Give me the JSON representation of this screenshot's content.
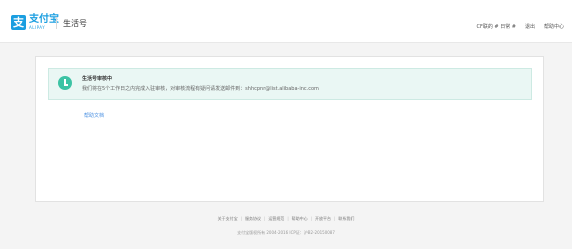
{
  "brand": {
    "logo_glyph": "支",
    "name_cn": "支付宝",
    "name_en": "ALIPAY",
    "color": "#1a9ee0"
  },
  "header": {
    "title": "生活号"
  },
  "topnav": {
    "account": "CF联的 # 日常 #",
    "logout": "退出",
    "help": "帮助中心"
  },
  "notice": {
    "icon": "check-circle-icon",
    "color": "#3cc3a4",
    "title": "生活号审核中",
    "description": "我们将在5个工作日之内完成入驻审核，对审核流程有疑问请发送邮件到：shhcpnr@list.alibaba-inc.com"
  },
  "help_link": "帮助文档",
  "footer": {
    "links": [
      "关于支付宝",
      "服务协议",
      "运营规范",
      "帮助中心",
      "开放平台",
      "联系我们"
    ],
    "copyright": "支付宝版权所有 2004-2016 ICP证：沪B2-20150087"
  }
}
